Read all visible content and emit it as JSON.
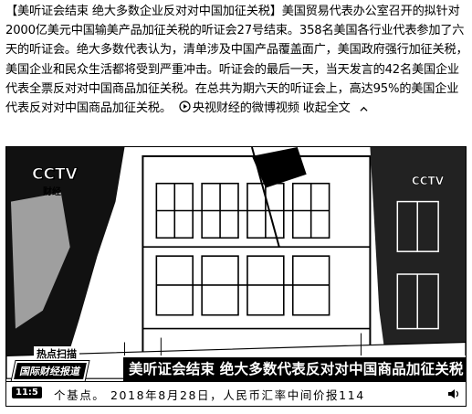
{
  "post": {
    "text_before": "【美听证会结束 绝大多数企业反对对中国加征关税】美国贸易代表办公室召开的拟针对2000亿美元中国输美产品加征关税的听证会27号结束。358名美国各行业代表参加了六天的听证会。绝大多数代表认为，清单涉及中国产品覆盖面广，美国政府强行加征关税，美国企业和民众生活都将受到严重冲击。听证会的最后一天，当天发言的42名美国企业代表全票反对对中国商品加征关税。在总共为期六天的听证会上，高达95%的美国企业代表反对对中国商品加征关税。",
    "video_link": "央视财经的微博视频",
    "collapse_label": "收起全文"
  },
  "video": {
    "channel_logo": "CCTV",
    "channel_sub": "财经",
    "right_logo": "CCTV",
    "hot_tag": "热点扫描",
    "show_tag": "国际财经报道",
    "headline": "美听证会结束 绝大多数代表反对对中国商品加征关税",
    "clock": "11:5",
    "ticker": "个基点。  2018年8月28日，人民币汇率中间价报114"
  },
  "colors": {
    "text": "#000000",
    "background": "#ffffff",
    "band": "#000000"
  },
  "icons": {
    "video_link": "play-circle-icon",
    "collapse": "chevron-up-icon",
    "sound": "speaker-icon"
  }
}
